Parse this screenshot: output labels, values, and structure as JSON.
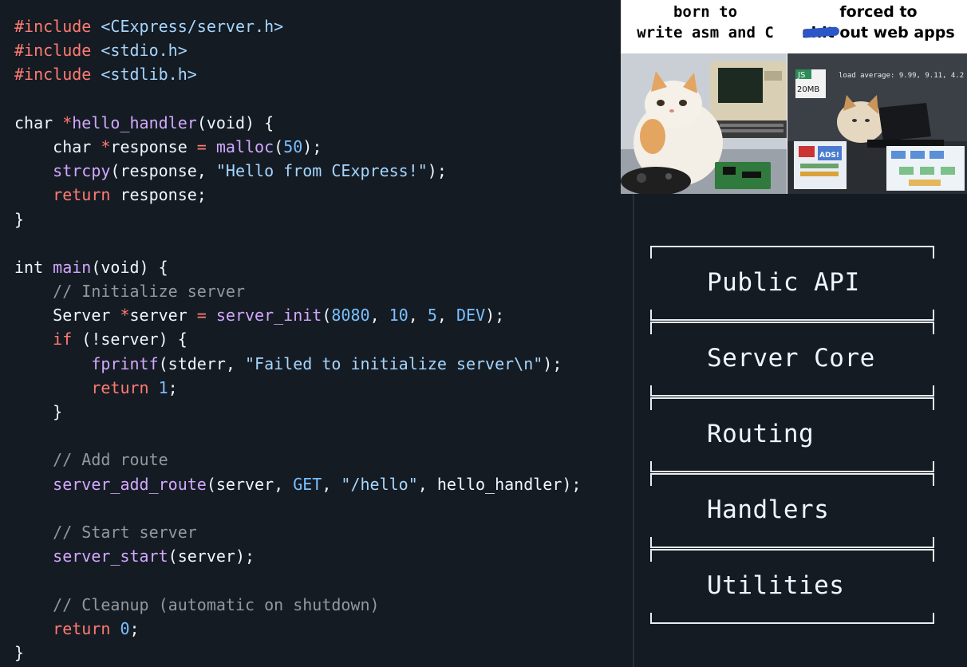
{
  "code": {
    "lines": [
      [
        [
          "#include ",
          "include"
        ],
        [
          "<CExpress/server.h>",
          "string"
        ]
      ],
      [
        [
          "#include ",
          "include"
        ],
        [
          "<stdio.h>",
          "string"
        ]
      ],
      [
        [
          "#include ",
          "include"
        ],
        [
          "<stdlib.h>",
          "string"
        ]
      ],
      [],
      [
        [
          "char ",
          "plain"
        ],
        [
          "*",
          "op"
        ],
        [
          "hello_handler",
          "func"
        ],
        [
          "(void) {",
          "plain"
        ]
      ],
      [
        [
          "    char ",
          "plain"
        ],
        [
          "*",
          "op"
        ],
        [
          "response ",
          "plain"
        ],
        [
          "=",
          "op"
        ],
        [
          " ",
          "plain"
        ],
        [
          "malloc",
          "func"
        ],
        [
          "(",
          "plain"
        ],
        [
          "50",
          "number"
        ],
        [
          ");",
          "plain"
        ]
      ],
      [
        [
          "    ",
          "plain"
        ],
        [
          "strcpy",
          "func"
        ],
        [
          "(response, ",
          "plain"
        ],
        [
          "\"Hello from CExpress!\"",
          "string"
        ],
        [
          ");",
          "plain"
        ]
      ],
      [
        [
          "    ",
          "plain"
        ],
        [
          "return",
          "keyword"
        ],
        [
          " response;",
          "plain"
        ]
      ],
      [
        [
          "}",
          "plain"
        ]
      ],
      [],
      [
        [
          "int ",
          "plain"
        ],
        [
          "main",
          "func"
        ],
        [
          "(void) {",
          "plain"
        ]
      ],
      [
        [
          "    // Initialize server",
          "comment"
        ]
      ],
      [
        [
          "    Server ",
          "plain"
        ],
        [
          "*",
          "op"
        ],
        [
          "server ",
          "plain"
        ],
        [
          "=",
          "op"
        ],
        [
          " ",
          "plain"
        ],
        [
          "server_init",
          "func"
        ],
        [
          "(",
          "plain"
        ],
        [
          "8080",
          "number"
        ],
        [
          ", ",
          "plain"
        ],
        [
          "10",
          "number"
        ],
        [
          ", ",
          "plain"
        ],
        [
          "5",
          "number"
        ],
        [
          ", ",
          "plain"
        ],
        [
          "DEV",
          "const"
        ],
        [
          ");",
          "plain"
        ]
      ],
      [
        [
          "    ",
          "plain"
        ],
        [
          "if",
          "keyword"
        ],
        [
          " (!server) {",
          "plain"
        ]
      ],
      [
        [
          "        ",
          "plain"
        ],
        [
          "fprintf",
          "func"
        ],
        [
          "(stderr, ",
          "plain"
        ],
        [
          "\"Failed to initialize server\\n\"",
          "string"
        ],
        [
          ");",
          "plain"
        ]
      ],
      [
        [
          "        ",
          "plain"
        ],
        [
          "return",
          "keyword"
        ],
        [
          " ",
          "plain"
        ],
        [
          "1",
          "number"
        ],
        [
          ";",
          "plain"
        ]
      ],
      [
        [
          "    }",
          "plain"
        ]
      ],
      [],
      [
        [
          "    // Add route",
          "comment"
        ]
      ],
      [
        [
          "    ",
          "plain"
        ],
        [
          "server_add_route",
          "func"
        ],
        [
          "(server, ",
          "plain"
        ],
        [
          "GET",
          "const"
        ],
        [
          ", ",
          "plain"
        ],
        [
          "\"/hello\"",
          "string"
        ],
        [
          ", hello_handler);",
          "plain"
        ]
      ],
      [],
      [
        [
          "    // Start server",
          "comment"
        ]
      ],
      [
        [
          "    ",
          "plain"
        ],
        [
          "server_start",
          "func"
        ],
        [
          "(server);",
          "plain"
        ]
      ],
      [],
      [
        [
          "    // Cleanup (automatic on shutdown)",
          "comment"
        ]
      ],
      [
        [
          "    ",
          "plain"
        ],
        [
          "return",
          "keyword"
        ],
        [
          " ",
          "plain"
        ],
        [
          "0",
          "number"
        ],
        [
          ";",
          "plain"
        ]
      ],
      [
        [
          "}",
          "plain"
        ]
      ]
    ]
  },
  "meme": {
    "caption_left": "born to\nwrite asm and C",
    "caption_right_top": "forced to",
    "caption_right_bottom": "shit out web apps",
    "badge_js": "JS",
    "badge_size": "20MB",
    "load_average": "load average: 9.99, 9.11, 4.2",
    "ads_label": "ADS!"
  },
  "architecture": {
    "layers": [
      {
        "label": "Public API"
      },
      {
        "label": "Server Core"
      },
      {
        "label": "Routing"
      },
      {
        "label": "Handlers"
      },
      {
        "label": "Utilities"
      }
    ]
  },
  "colors": {
    "background": "#151b23",
    "keyword": "#ff7b72",
    "function": "#d2a8ff",
    "string": "#a5d6ff",
    "number": "#79c0ff",
    "comment": "#9198a1",
    "text": "#f0f6fc"
  }
}
